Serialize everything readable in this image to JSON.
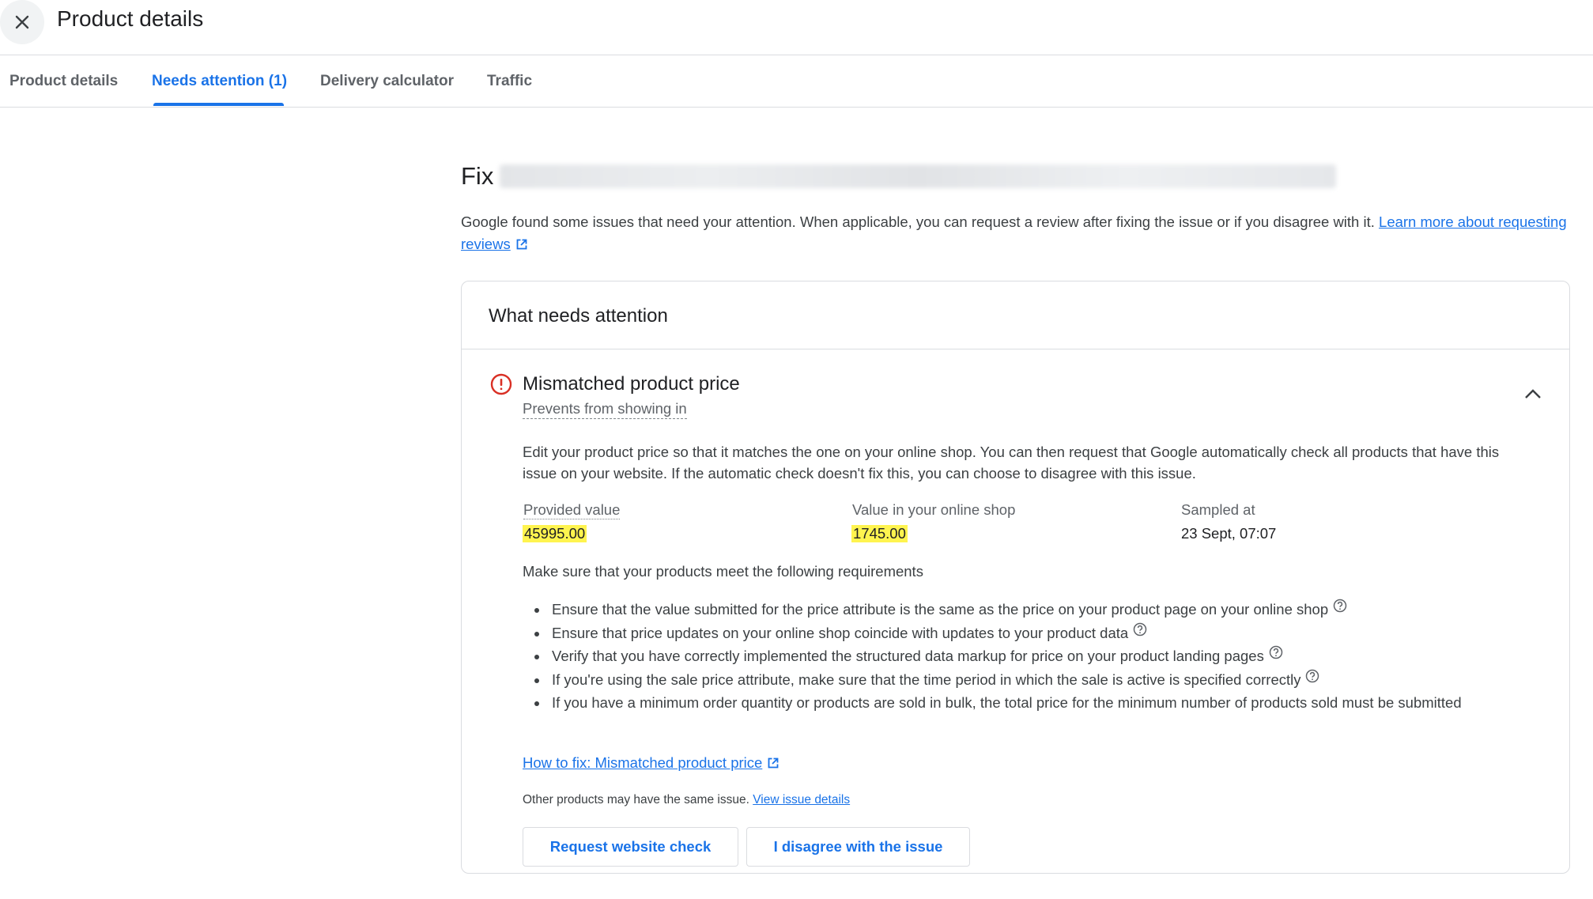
{
  "header": {
    "title": "Product details",
    "close_icon": "close-icon"
  },
  "tabs": [
    {
      "label": "Product details",
      "active": false
    },
    {
      "label": "Needs attention (1)",
      "active": true
    },
    {
      "label": "Delivery calculator",
      "active": false
    },
    {
      "label": "Traffic",
      "active": false
    }
  ],
  "page": {
    "heading_prefix": "Fix",
    "intro_text": "Google found some issues that need your attention. When applicable, you can request a review after fixing the issue or if you disagree with it. ",
    "intro_link": "Learn more about requesting reviews"
  },
  "card": {
    "title": "What needs attention",
    "issue": {
      "title": "Mismatched product price",
      "subtitle": "Prevents from showing in",
      "description": "Edit your product price so that it matches the one on your online shop. You can then request that Google automatically check all products that have this issue on your website. If the automatic check doesn't fix this, you can choose to disagree with this issue.",
      "values": [
        {
          "label": "Provided value",
          "value": "45995.00"
        },
        {
          "label": "Value in your online shop",
          "value": "1745.00"
        },
        {
          "label": "Sampled at",
          "value": "23 Sept, 07:07"
        }
      ],
      "requirements_heading": "Make sure that your products meet the following requirements",
      "requirements": [
        "Ensure that the value submitted for the price attribute is the same as the price on your product page on your online shop",
        "Ensure that price updates on your online shop coincide with updates to your product data",
        "Verify that you have correctly implemented the structured data markup for price on your product landing pages",
        "If you're using the sale price attribute, make sure that the time period in which the sale is active is specified correctly",
        "If you have a minimum order quantity or products are sold in bulk, the total price for the minimum number of products sold must be submitted"
      ],
      "howto_link": "How to fix: Mismatched product price",
      "other_text": "Other products may have the same issue. ",
      "other_link": "View issue details",
      "buttons": {
        "request": "Request website check",
        "disagree": "I disagree with the issue"
      }
    }
  },
  "colors": {
    "accent": "#1a73e8",
    "error": "#d93025",
    "highlight": "#fff44f"
  }
}
